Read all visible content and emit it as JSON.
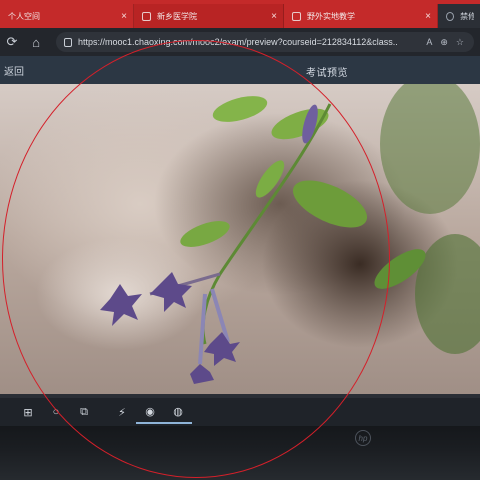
{
  "browser": {
    "tabs": [
      {
        "title": "个人空间",
        "close": "×"
      },
      {
        "title": "新乡医学院",
        "close": "×"
      },
      {
        "title": "野外实地教学",
        "close": "×"
      },
      {
        "title": "禁修",
        "close": ""
      }
    ],
    "address": {
      "url": "https://mooc1.chaoxing.com/mooc2/exam/preview?courseid=212834112&class..."
    }
  },
  "page": {
    "back_label": "返回",
    "title": "考试预览"
  },
  "colors": {
    "tab_strip": "#c42a2a",
    "annotation_circle": "#d4202a",
    "taskbar": "#1f2329"
  },
  "icons": {
    "refresh": "refresh-icon",
    "home": "home-icon",
    "lock": "lock-icon",
    "windows": "windows-start-icon",
    "search": "search-icon",
    "taskview": "taskview-icon",
    "winamp": "lightning-app-icon",
    "edge": "edge-browser-icon",
    "app2": "browser-app-icon"
  }
}
